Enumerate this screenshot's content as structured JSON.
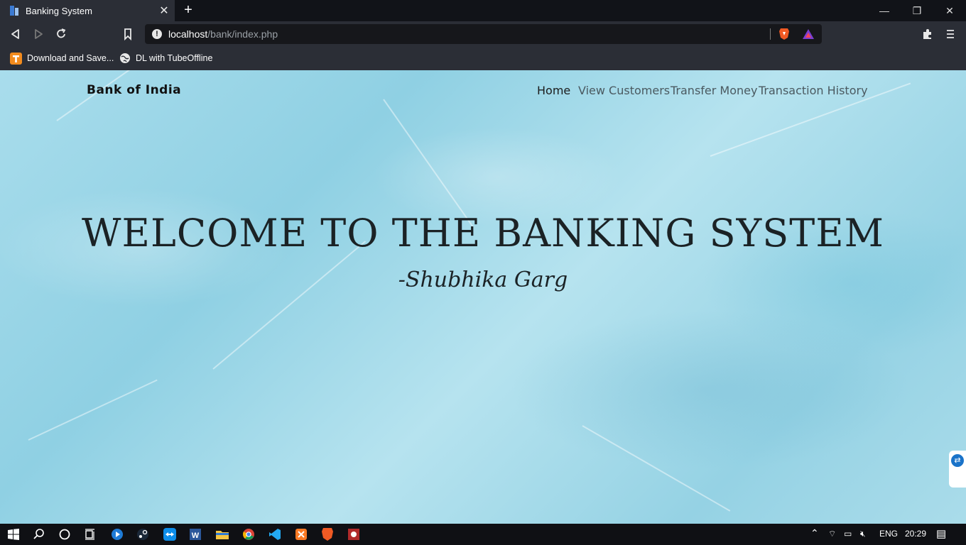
{
  "browser": {
    "tab_title": "Banking System",
    "tab_close": "✕",
    "new_tab": "+",
    "window_minimize": "—",
    "window_restore": "❐",
    "window_close": "✕",
    "url_host": "localhost",
    "url_path": "/bank/index.php",
    "bookmarks": [
      {
        "label": "Download and Save...",
        "icon": "tubeoffline-t-icon"
      },
      {
        "label": "DL with TubeOffline",
        "icon": "globe-icon"
      }
    ]
  },
  "page": {
    "brand": "Bank of India",
    "nav": [
      {
        "label": "Home",
        "active": true
      },
      {
        "label": "View Customers",
        "active": false
      },
      {
        "label": "Transfer Money",
        "active": false
      },
      {
        "label": "Transaction History",
        "active": false
      }
    ],
    "hero_title": "WELCOME TO THE BANKING SYSTEM",
    "hero_subtitle": "-Shubhika Garg"
  },
  "taskbar": {
    "language": "ENG",
    "time": "20:29"
  },
  "colors": {
    "titlebar": "#111318",
    "toolbar": "#2b2e36",
    "page_background": "#a9ddec",
    "taskbar": "#0f1014"
  }
}
